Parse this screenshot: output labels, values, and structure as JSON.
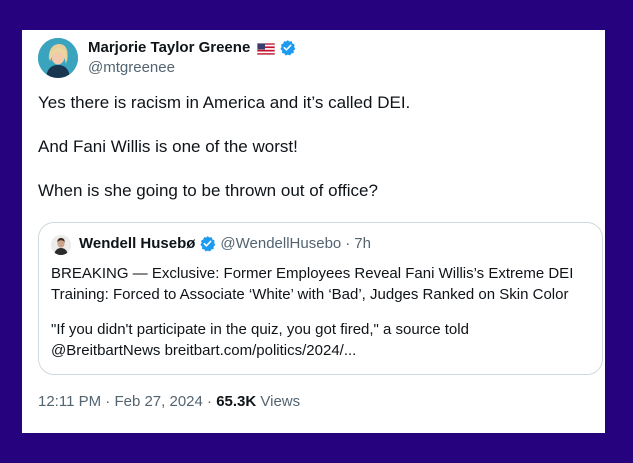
{
  "author": {
    "name": "Marjorie Taylor Greene",
    "handle": "@mtgreenee",
    "flag_icon": "us-flag-icon",
    "verified_icon": "verified-badge-icon",
    "verified_color": "#1d9bf0"
  },
  "tweet": {
    "paragraphs": [
      "Yes there is racism in America and it’s called DEI.",
      "And Fani Willis is one of the worst!",
      "When is she going to be thrown out of office?"
    ]
  },
  "quote": {
    "name": "Wendell Husebø",
    "handle": "@WendellHusebo",
    "separator": "·",
    "time": "7h",
    "line1": "BREAKING — Exclusive: Former Employees Reveal Fani Willis’s Extreme DEI",
    "line2": "Training: Forced to Associate ‘White’ with ‘Bad’, Judges Ranked on Skin Color",
    "line3": "\"If you didn't participate in the quiz, you got fired,\" a source told",
    "line4": "@BreitbartNews breitbart.com/politics/2024/..."
  },
  "meta": {
    "time": "12:11 PM",
    "separator": "·",
    "date": "Feb 27, 2024",
    "views_count": "65.3K",
    "views_label": "Views"
  },
  "colors": {
    "page_background": "#26027f",
    "card_background": "#ffffff",
    "text_primary": "#0f1419",
    "text_secondary": "#536471",
    "border": "#cfd9de"
  }
}
